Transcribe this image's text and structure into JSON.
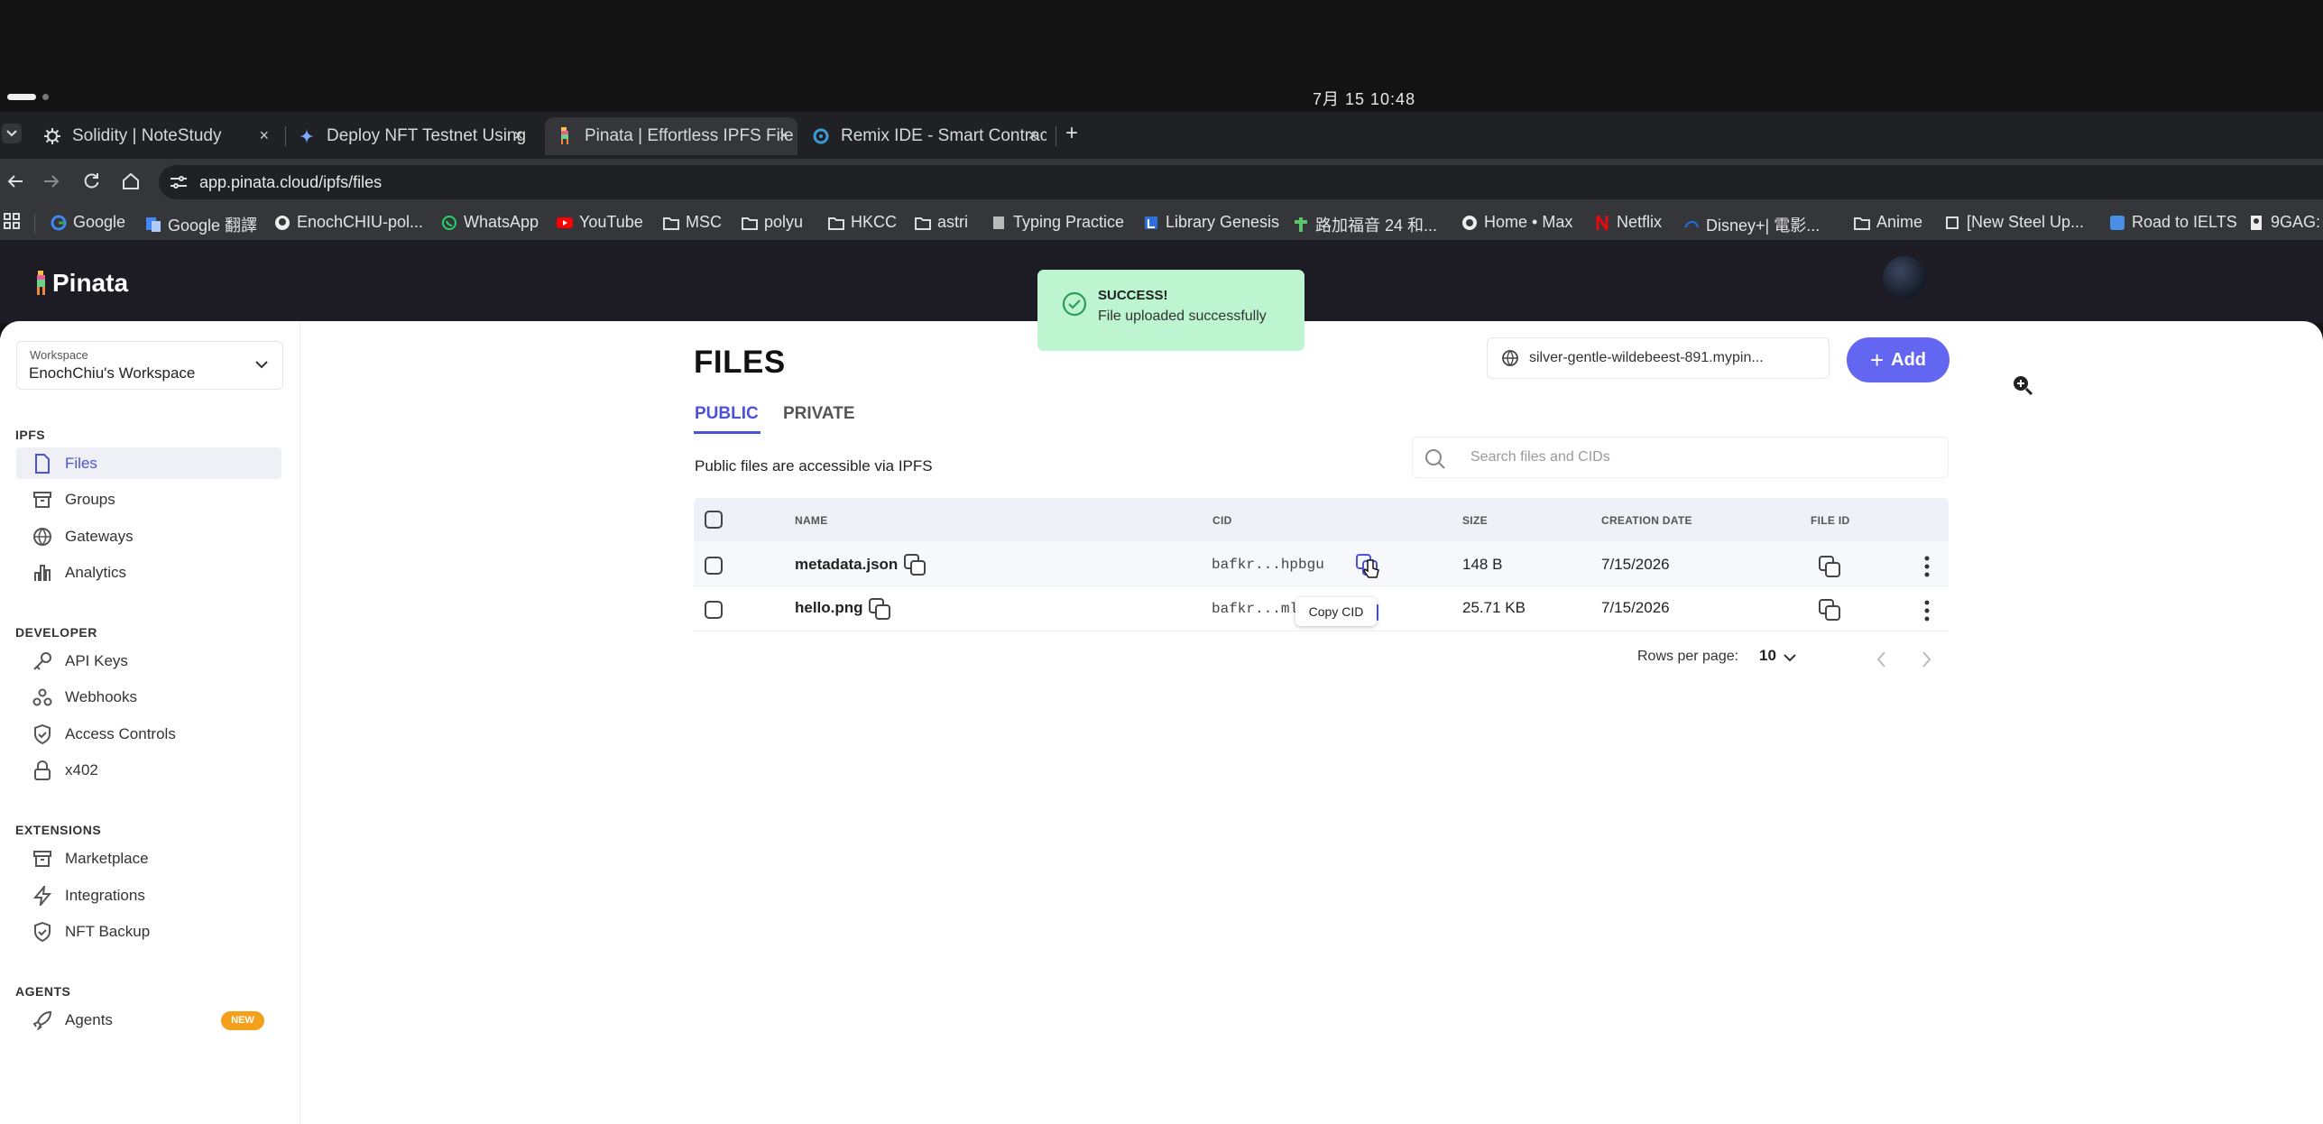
{
  "os": {
    "clock": "7月 15  10:48"
  },
  "browser": {
    "tabs": [
      {
        "title": "Solidity | NoteStudy",
        "close": "×"
      },
      {
        "title": "Deploy NFT Testnet Using",
        "close": "×"
      },
      {
        "title": "Pinata | Effortless IPFS File",
        "close": "×"
      },
      {
        "title": "Remix IDE - Smart Contract",
        "close": "×"
      }
    ],
    "new_tab": "+",
    "url": "app.pinata.cloud/ipfs/files",
    "bookmarks": [
      "Google",
      "Google 翻譯",
      "EnochCHIU-pol...",
      "WhatsApp",
      "YouTube",
      "MSC",
      "polyu",
      "HKCC",
      "astri",
      "Typing Practice",
      "Library Genesis",
      "路加福音 24 和...",
      "Home • Max",
      "Netflix",
      "Disney+| 電影...",
      "Anime",
      "[New Steel Up...",
      "Road to IELTS",
      "9GAG:"
    ]
  },
  "app": {
    "logo": "Pinata",
    "workspace": {
      "label": "Workspace",
      "name": "EnochChiu's Workspace"
    },
    "sidebar": {
      "ipfs_title": "IPFS",
      "ipfs": [
        "Files",
        "Groups",
        "Gateways",
        "Analytics"
      ],
      "developer_title": "DEVELOPER",
      "developer": [
        "API Keys",
        "Webhooks",
        "Access Controls",
        "x402"
      ],
      "extensions_title": "EXTENSIONS",
      "extensions": [
        "Marketplace",
        "Integrations",
        "NFT Backup"
      ],
      "agents_title": "AGENTS",
      "agents": [
        "Agents"
      ],
      "agents_badge": "NEW"
    },
    "toast": {
      "title": "SUCCESS!",
      "message": "File uploaded successfully"
    },
    "main": {
      "title": "FILES",
      "gateway": "silver-gentle-wildebeest-891.mypin...",
      "add_label": "Add",
      "tabs": [
        "PUBLIC",
        "PRIVATE"
      ],
      "description": "Public files are accessible via IPFS",
      "search_placeholder": "Search files and CIDs",
      "columns": [
        "NAME",
        "CID",
        "SIZE",
        "CREATION DATE",
        "FILE ID"
      ],
      "rows": [
        {
          "name": "metadata.json",
          "cid": "bafkr...hpbgu",
          "size": "148 B",
          "date": "7/15/2026"
        },
        {
          "name": "hello.png",
          "cid": "bafkr...ml",
          "size": "25.71 KB",
          "date": "7/15/2026"
        }
      ],
      "tooltip": "Copy CID",
      "rows_per_page_label": "Rows per page:",
      "rows_per_page_value": "10"
    }
  }
}
